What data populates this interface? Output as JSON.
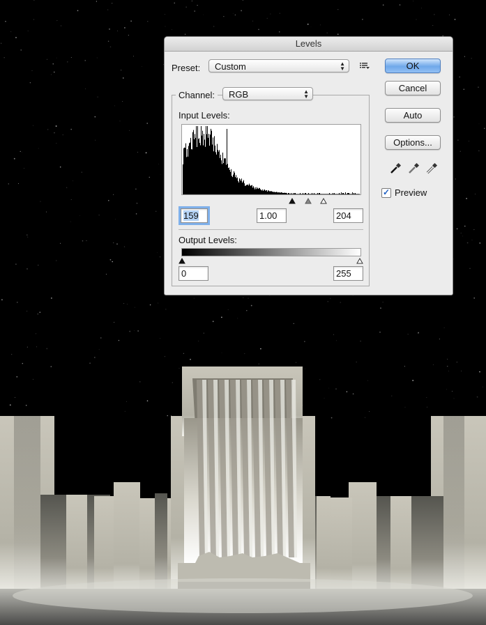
{
  "dialog": {
    "title": "Levels",
    "preset_label": "Preset:",
    "preset_value": "Custom",
    "preset_menu_icon": "list-menu-icon",
    "channel_label": "Channel:",
    "channel_value": "RGB",
    "input_levels_label": "Input Levels:",
    "input_black": "159",
    "input_gamma": "1.00",
    "input_white": "204",
    "output_levels_label": "Output Levels:",
    "output_black": "0",
    "output_white": "255",
    "buttons": {
      "ok": "OK",
      "cancel": "Cancel",
      "auto": "Auto",
      "options": "Options..."
    },
    "eyedroppers": [
      "black-eyedropper-icon",
      "gray-eyedropper-icon",
      "white-eyedropper-icon"
    ],
    "preview_label": "Preview",
    "preview_checked": true
  },
  "colors": {
    "accent_button": "#6fa8ea",
    "dialog_bg": "#ececec",
    "canvas_bg": "#000000"
  }
}
